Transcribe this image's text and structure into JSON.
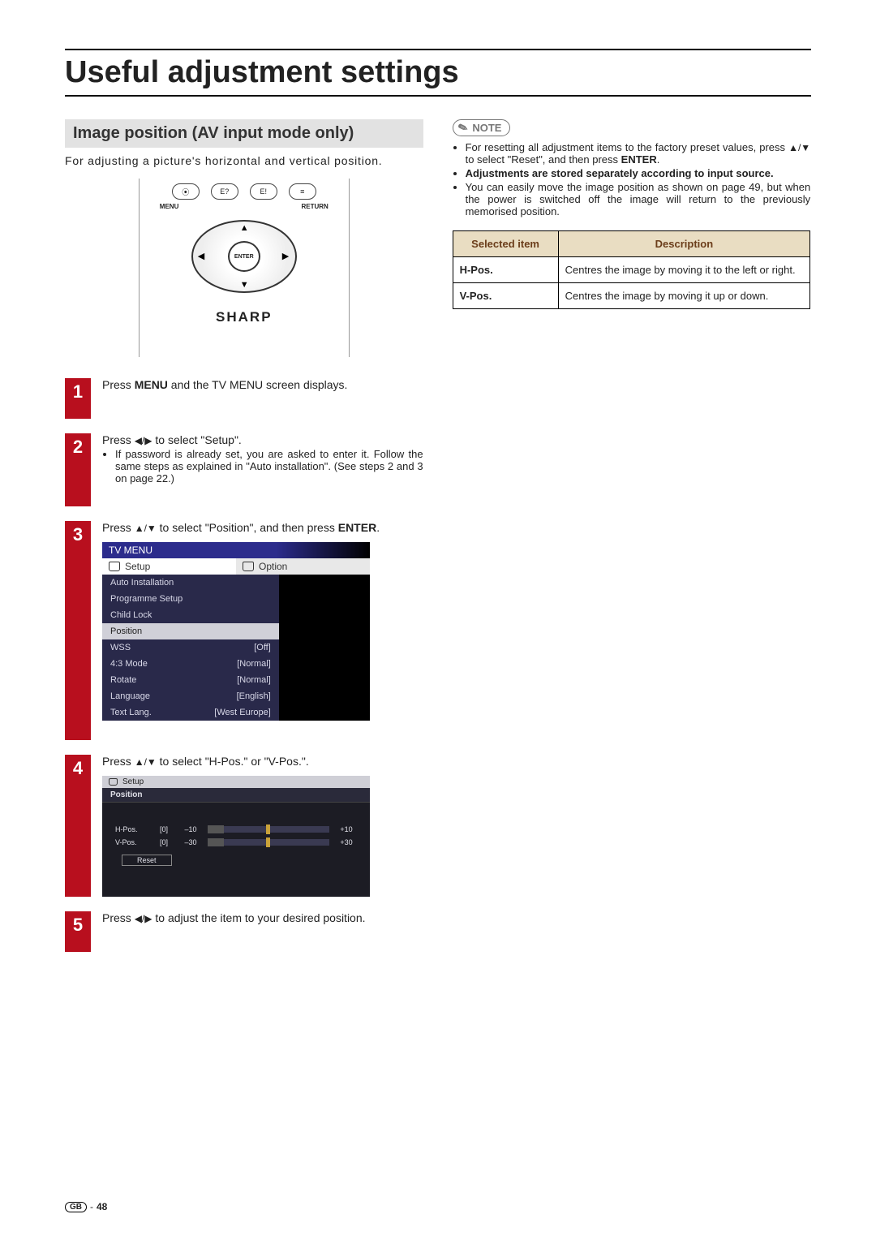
{
  "page_title": "Useful adjustment settings",
  "section_heading": "Image position (AV input mode only)",
  "intro": "For adjusting a picture's horizontal and vertical position.",
  "remote": {
    "menu_label": "MENU",
    "return_label": "RETURN",
    "enter_label": "ENTER",
    "brand": "SHARP"
  },
  "steps": [
    {
      "num": "1",
      "text_before": "Press ",
      "bold1": "MENU",
      "text_after": " and the TV MENU screen displays."
    },
    {
      "num": "2",
      "line1_a": "Press ",
      "line1_arrows": "◀/▶",
      "line1_b": " to select \"Setup\".",
      "bullet": "If password is already set, you are asked to enter it. Follow the same steps as explained in \"Auto installation\". (See steps 2 and 3 on page 22.)"
    },
    {
      "num": "3",
      "line_a": "Press ",
      "arrows": "▲/▼",
      "line_b": " to select \"Position\", and then press ",
      "bold": "ENTER",
      "line_c": "."
    },
    {
      "num": "4",
      "line_a": "Press ",
      "arrows": "▲/▼",
      "line_b": " to select \"H-Pos.\" or \"V-Pos.\"."
    },
    {
      "num": "5",
      "line_a": "Press ",
      "arrows": "◀/▶",
      "line_b": " to adjust the item to your desired position."
    }
  ],
  "tvmenu": {
    "title": "TV MENU",
    "tabs": {
      "setup": "Setup",
      "option": "Option"
    },
    "rows": [
      {
        "label": "Auto Installation",
        "value": ""
      },
      {
        "label": "Programme Setup",
        "value": ""
      },
      {
        "label": "Child Lock",
        "value": ""
      },
      {
        "label": "Position",
        "value": "",
        "selected": true
      },
      {
        "label": "WSS",
        "value": "[Off]"
      },
      {
        "label": "4:3 Mode",
        "value": "[Normal]"
      },
      {
        "label": "Rotate",
        "value": "[Normal]"
      },
      {
        "label": "Language",
        "value": "[English]"
      },
      {
        "label": "Text Lang.",
        "value": "[West Europe]"
      }
    ]
  },
  "posgfx": {
    "header": "Setup",
    "sub": "Position",
    "rows": [
      {
        "label": "H-Pos.",
        "val": "[0]",
        "min": "–10",
        "max": "+10"
      },
      {
        "label": "V-Pos.",
        "val": "[0]",
        "min": "–30",
        "max": "+30"
      }
    ],
    "reset": "Reset"
  },
  "note_label": "NOTE",
  "notes": {
    "n1a": "For resetting all adjustment items to the factory preset values, press ",
    "n1arrows": "▲/▼",
    "n1b": " to select \"Reset\", and then press ",
    "n1bold": "ENTER",
    "n1c": ".",
    "n2": "Adjustments are stored separately according to input source.",
    "n3": "You can easily move the image position as shown on page 49, but when the power is switched off the image will return to the previously memorised position."
  },
  "table": {
    "headers": {
      "item": "Selected item",
      "desc": "Description"
    },
    "rows": [
      {
        "item": "H-Pos.",
        "desc": "Centres the image by moving it to the left or right."
      },
      {
        "item": "V-Pos.",
        "desc": "Centres the image by moving it up or down."
      }
    ]
  },
  "footer": {
    "gb": "GB",
    "page": "48"
  }
}
